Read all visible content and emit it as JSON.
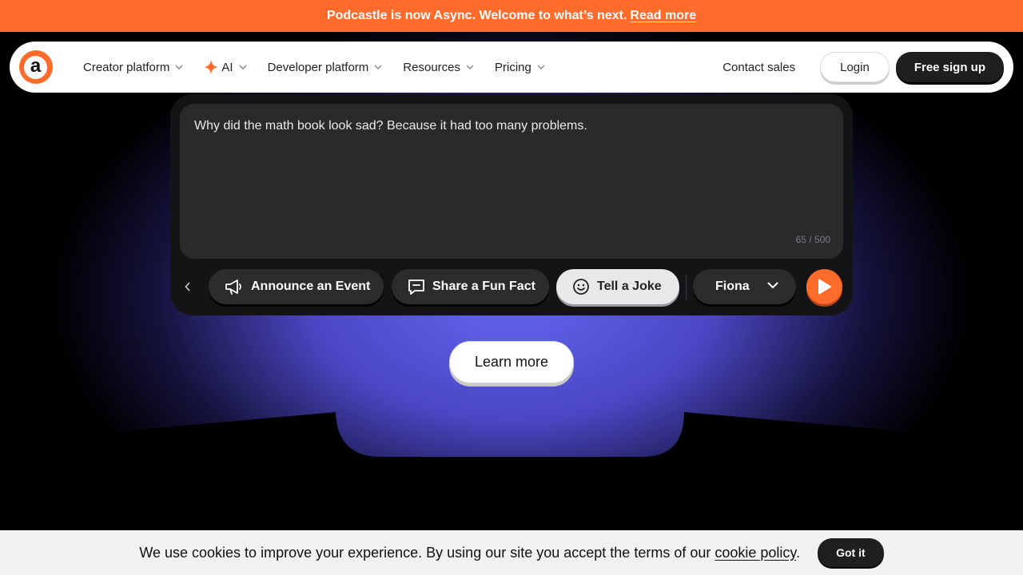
{
  "announcement": {
    "text": "Podcastle is now Async. Welcome to what’s next.",
    "link": "Read more"
  },
  "nav": {
    "logo_letter": "a",
    "items": [
      {
        "label": "Creator platform",
        "icon": "chevron-down-icon"
      },
      {
        "label": "AI",
        "icon": "chevron-down-icon",
        "leading_icon": "sparkle-icon"
      },
      {
        "label": "Developer platform",
        "icon": "chevron-down-icon"
      },
      {
        "label": "Resources",
        "icon": "chevron-down-icon"
      },
      {
        "label": "Pricing",
        "icon": "chevron-down-icon"
      }
    ],
    "contact": "Contact sales",
    "login": "Login",
    "signup": "Free sign up"
  },
  "widget": {
    "text": "Why did the math book look sad? Because it had too many problems.",
    "char_count": "65 / 500",
    "chips": [
      {
        "label": "Announce an Event",
        "icon": "megaphone-icon",
        "active": false
      },
      {
        "label": "Share a Fun Fact",
        "icon": "chat-bubble-icon",
        "active": false
      },
      {
        "label": "Tell a Joke",
        "icon": "smiley-icon",
        "active": true
      }
    ],
    "voice": "Fiona"
  },
  "learn_more": "Learn more",
  "cookie": {
    "text": "We use cookies to improve your experience. By using our site you accept the terms of our",
    "link": "cookie policy",
    "suffix": ".",
    "button": "Got it"
  },
  "colors": {
    "brand": "#ff6b2b",
    "glow": "#6366f1",
    "dark": "#141416"
  }
}
